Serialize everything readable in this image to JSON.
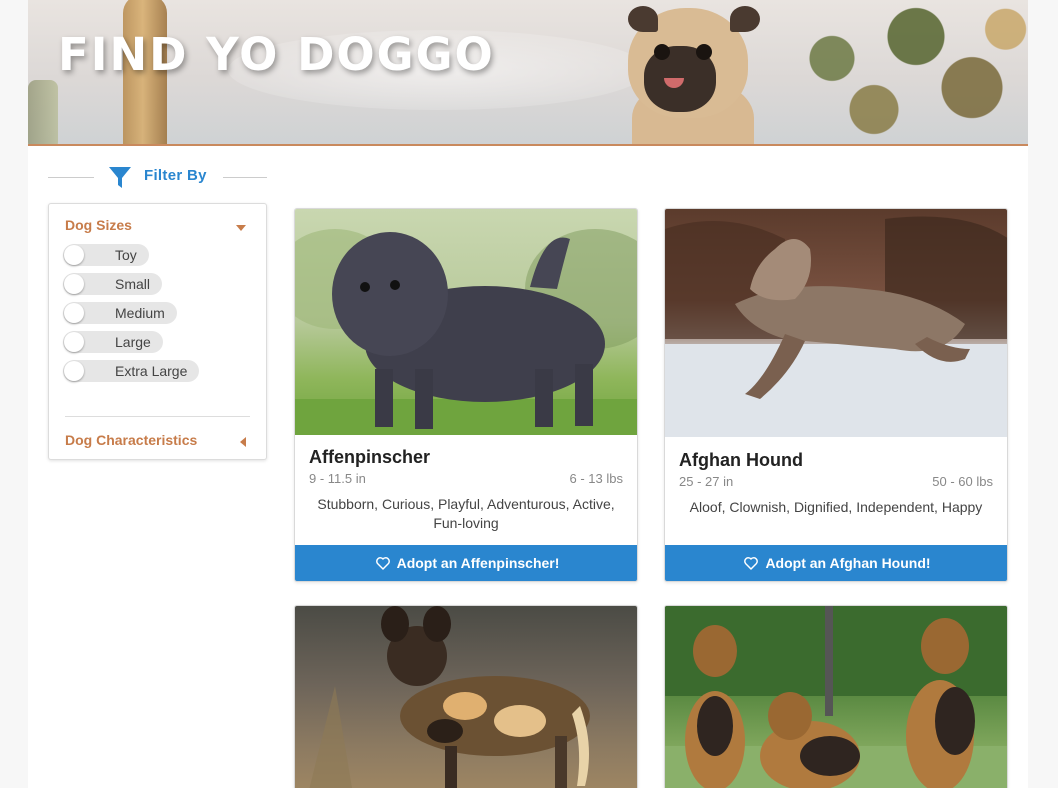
{
  "header": {
    "title": "FIND YO DOGGO"
  },
  "filter": {
    "title": "Filter By",
    "sections": {
      "sizes": {
        "title": "Dog Sizes",
        "options": [
          "Toy",
          "Small",
          "Medium",
          "Large",
          "Extra Large"
        ]
      },
      "characteristics": {
        "title": "Dog Characteristics"
      }
    }
  },
  "dogs": [
    {
      "name": "Affenpinscher",
      "height": "9 - 11.5 in",
      "weight": "6 - 13 lbs",
      "traits": "Stubborn, Curious, Playful, Adventurous, Active, Fun-loving",
      "adopt_label": "Adopt an Affenpinscher!"
    },
    {
      "name": "Afghan Hound",
      "height": "25 - 27 in",
      "weight": "50 - 60 lbs",
      "traits": "Aloof, Clownish, Dignified, Independent, Happy",
      "adopt_label": "Adopt an Afghan Hound!"
    }
  ],
  "colors": {
    "accent": "#2a86cf",
    "section_title": "#c77c4a",
    "banner_border": "#c9895d"
  }
}
